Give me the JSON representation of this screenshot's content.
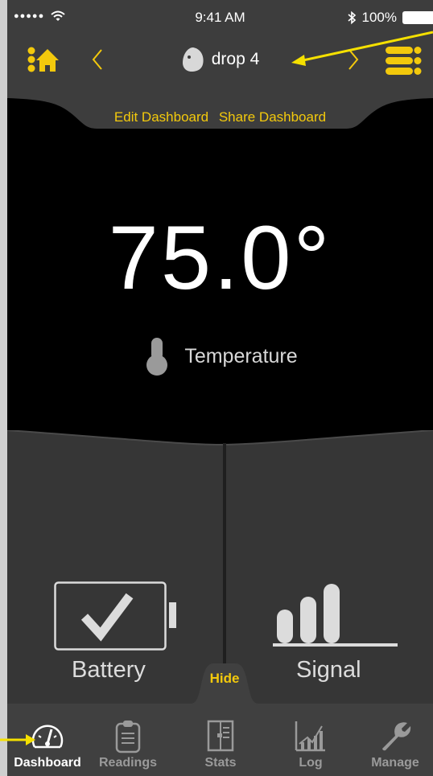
{
  "status_bar": {
    "signal_dots": "●●●●●",
    "time": "9:41 AM",
    "battery_pct": "100%"
  },
  "nav": {
    "title": "drop 4"
  },
  "edit": {
    "edit_label": "Edit Dashboard",
    "share_label": "Share Dashboard"
  },
  "reading": {
    "value": "75.0°",
    "label": "Temperature"
  },
  "status": {
    "battery_label": "Battery",
    "signal_label": "Signal",
    "hide_label": "Hide"
  },
  "tabs": [
    {
      "label": "Dashboard",
      "icon": "gauge-icon"
    },
    {
      "label": "Readings",
      "icon": "clipboard-icon"
    },
    {
      "label": "Stats",
      "icon": "stats-icon"
    },
    {
      "label": "Log",
      "icon": "chart-icon"
    },
    {
      "label": "Manage",
      "icon": "wrench-icon"
    }
  ],
  "colors": {
    "accent": "#f3c90c",
    "annotation": "#f5e000",
    "bar": "#3d3d3d",
    "lower_panel": "#363636"
  }
}
